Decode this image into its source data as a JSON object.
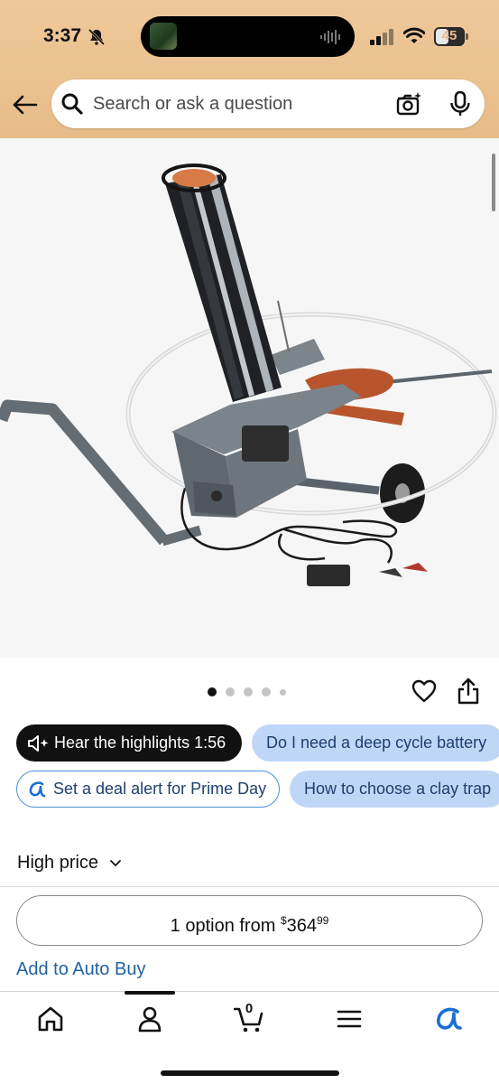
{
  "status_bar": {
    "time": "3:37",
    "battery": "45"
  },
  "search": {
    "placeholder": "Search or ask a question"
  },
  "gallery": {
    "dot_count": 5,
    "active_dot": 0
  },
  "chips": {
    "highlights": "Hear the highlights 1:56",
    "question_battery": "Do I need a deep cycle battery",
    "deal_alert": "Set a deal alert for Prime Day",
    "question_choose": "How to choose a clay trap"
  },
  "price": {
    "label": "High price",
    "options_text": "1 option from ",
    "currency": "$",
    "whole": "364",
    "fraction": "99"
  },
  "autobuy": "Add to Auto Buy",
  "nav": {
    "cart_count": "0"
  },
  "colors": {
    "header_bg": "#e7bc88",
    "chip_blue": "#bfd7f7",
    "link_blue": "#2162a1",
    "prime_blue": "#1a6fd6"
  },
  "icons": [
    "back-arrow-icon",
    "search-icon",
    "camera-search-icon",
    "microphone-icon",
    "heart-icon",
    "share-icon",
    "speaker-icon",
    "rufus-icon",
    "home-icon",
    "account-icon",
    "cart-icon",
    "menu-icon"
  ]
}
